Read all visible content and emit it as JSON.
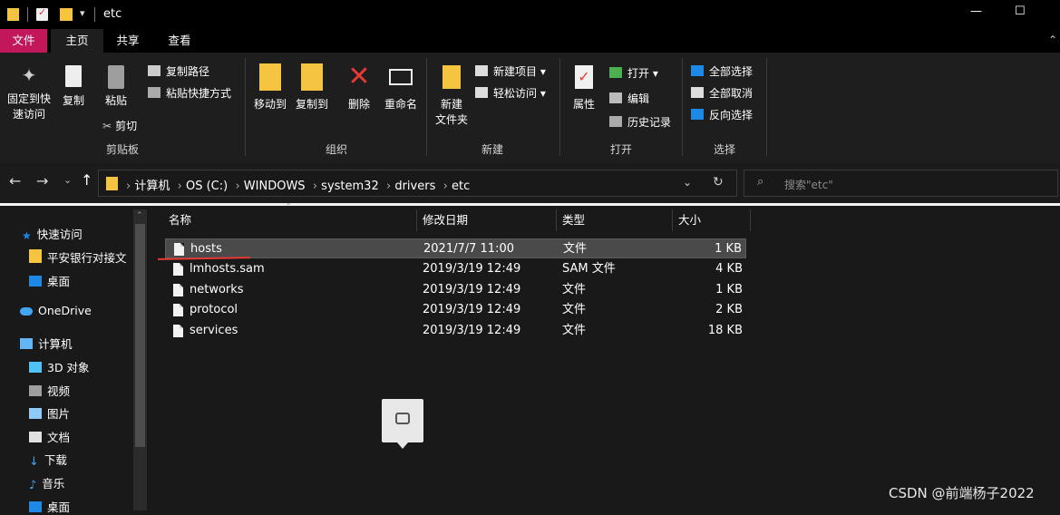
{
  "titlebar": {
    "title": "etc",
    "min_glyph": "—",
    "max_glyph": "☐"
  },
  "tabs": [
    {
      "label": "文件"
    },
    {
      "label": "主页"
    },
    {
      "label": "共享"
    },
    {
      "label": "查看"
    }
  ],
  "ribbon": {
    "clipboard": {
      "pin_label": [
        "固定到快",
        "速访问"
      ],
      "copy_label": "复制",
      "paste_label": "粘贴",
      "copy_path": "复制路径",
      "paste_shortcut": "粘贴快捷方式",
      "cut": "剪切",
      "group": "剪贴板"
    },
    "organize": {
      "move_to": "移动到",
      "copy_to": "复制到",
      "delete": "删除",
      "rename": "重命名",
      "group": "组织"
    },
    "new": {
      "new_folder": [
        "新建",
        "文件夹"
      ],
      "new_item": "新建项目",
      "easy_access": "轻松访问",
      "group": "新建"
    },
    "open": {
      "properties": "属性",
      "open": "打开",
      "edit": "编辑",
      "history": "历史记录",
      "group": "打开"
    },
    "select": {
      "select_all": "全部选择",
      "select_none": "全部取消",
      "invert": "反向选择",
      "group": "选择"
    }
  },
  "address": {
    "crumbs": [
      "计算机",
      "OS (C:)",
      "WINDOWS",
      "system32",
      "drivers",
      "etc"
    ],
    "search_placeholder": "搜索\"etc\""
  },
  "sidebar": {
    "items": [
      {
        "label": "快速访问",
        "icon": "star-icon"
      },
      {
        "label": "平安银行对接文",
        "icon": "folder-icon"
      },
      {
        "label": "桌面",
        "icon": "desktop-icon"
      },
      {
        "label": "OneDrive",
        "icon": "cloud-icon"
      },
      {
        "label": "计算机",
        "icon": "computer-icon"
      },
      {
        "label": "3D 对象",
        "icon": "cube-icon"
      },
      {
        "label": "视频",
        "icon": "video-icon"
      },
      {
        "label": "图片",
        "icon": "pictures-icon"
      },
      {
        "label": "文档",
        "icon": "document-icon"
      },
      {
        "label": "下载",
        "icon": "download-icon"
      },
      {
        "label": "音乐",
        "icon": "music-icon"
      },
      {
        "label": "桌面",
        "icon": "desktop-icon"
      }
    ]
  },
  "columns": [
    "名称",
    "修改日期",
    "类型",
    "大小"
  ],
  "files": [
    {
      "name": "hosts",
      "date": "2021/7/7 11:00",
      "type": "文件",
      "size": "1 KB"
    },
    {
      "name": "lmhosts.sam",
      "date": "2019/3/19 12:49",
      "type": "SAM 文件",
      "size": "4 KB"
    },
    {
      "name": "networks",
      "date": "2019/3/19 12:49",
      "type": "文件",
      "size": "1 KB"
    },
    {
      "name": "protocol",
      "date": "2019/3/19 12:49",
      "type": "文件",
      "size": "2 KB"
    },
    {
      "name": "services",
      "date": "2019/3/19 12:49",
      "type": "文件",
      "size": "18 KB"
    }
  ],
  "watermark": "CSDN @前端杨子2022",
  "colors": {
    "file_tab": "#c2185b",
    "accent_blue": "#1e88e5",
    "folder_yellow": "#f5c542",
    "selected_row": "#4a4a4a"
  }
}
